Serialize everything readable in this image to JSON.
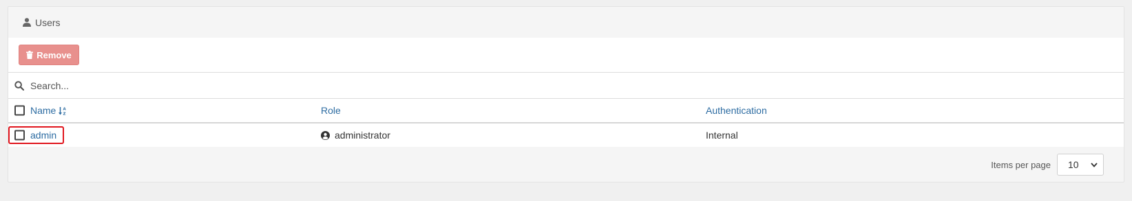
{
  "panel": {
    "title": "Users",
    "title_icon": "user-icon"
  },
  "toolbar": {
    "remove_label": "Remove",
    "remove_icon": "trash-icon"
  },
  "search": {
    "placeholder": "Search...",
    "value": ""
  },
  "table": {
    "columns": [
      {
        "label": "Name",
        "sort_icon": "sort-alpha-down-icon"
      },
      {
        "label": "Role"
      },
      {
        "label": "Authentication"
      }
    ],
    "rows": [
      {
        "name": "admin",
        "role": "administrator",
        "role_icon": "user-circle-icon",
        "authentication": "Internal"
      }
    ]
  },
  "pagination": {
    "items_per_page_label": "Items per page",
    "items_per_page_value": "10"
  },
  "colors": {
    "link": "#2d6ca2",
    "remove_button": "#e8908d",
    "highlight": "#e0141c"
  }
}
